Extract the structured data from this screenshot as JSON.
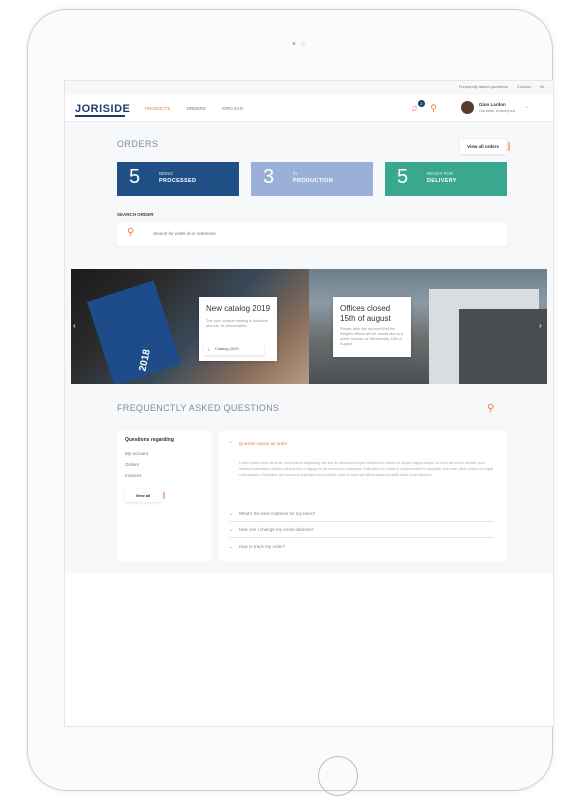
{
  "topbar": {
    "links": [
      "Frequently asked questions",
      "Contact",
      "NL"
    ]
  },
  "header": {
    "logo": "JORISIDE",
    "nav": [
      "PRODUCTS",
      "ORDERS",
      "INFO ZAG"
    ],
    "notification_count": "2",
    "user_name": "Gino Lardon",
    "user_company": "Gantalia, Antwerpen"
  },
  "orders": {
    "title": "ORDERS",
    "view_all": "View all orders",
    "cards": [
      {
        "count": "5",
        "line1": "BEING",
        "line2": "PROCESSED",
        "color": "#1f4f85"
      },
      {
        "count": "3",
        "line1": "IN",
        "line2": "PRODUCTION",
        "color": "#9bb0d9"
      },
      {
        "count": "5",
        "line1": "READY FOR",
        "line2": "DELIVERY",
        "color": "#3aa88f"
      }
    ],
    "search_label": "SEARCH ORDER",
    "search_placeholder": "Search for order id or reference"
  },
  "banners": [
    {
      "title": "New catalog 2019",
      "desc": "The new Joriside catalog is available and can be downloaded.",
      "button": "Catalog 2019",
      "book_year": "2018"
    },
    {
      "title": "Offices closed\n15th of august",
      "desc": "Please take into account that the Belgian offices will be closed due to a public holiday on Wednesday 15th of August."
    }
  ],
  "faq": {
    "title": "FREQUENCTLY ASKED QUESTIONS",
    "left_heading": "Questions regarding",
    "left_items": [
      "My account",
      "Orders",
      "Invoices"
    ],
    "view_all": "View all",
    "questions": [
      {
        "q": "Question about an order",
        "open": true
      },
      {
        "q": "What's the best mattress for my back?",
        "open": false
      },
      {
        "q": "How can I change my email address?",
        "open": false
      },
      {
        "q": "How to track my order?",
        "open": false
      }
    ],
    "answer": "Lorem ipsum dolor sit amet, consectetur adipiscing elit, sed do eiusmod tempor incididunt ut labore et dolore magna aliqua. Ut enim ad minim veniam, quis nostrud exercitation ullamco laboris nisi ut aliquip ex ea commodo consequat. Duis aute irure dolor in reprehenderit in voluptate velit esse cillum dolore eu fugiat nulla pariatur. Excepteur sint occaecat cupidatat non proident, sunt in culpa qui officia deserunt mollit anim id est laborum."
  },
  "colors": {
    "accent": "#f07a3c",
    "navy": "#1e3e6a"
  }
}
